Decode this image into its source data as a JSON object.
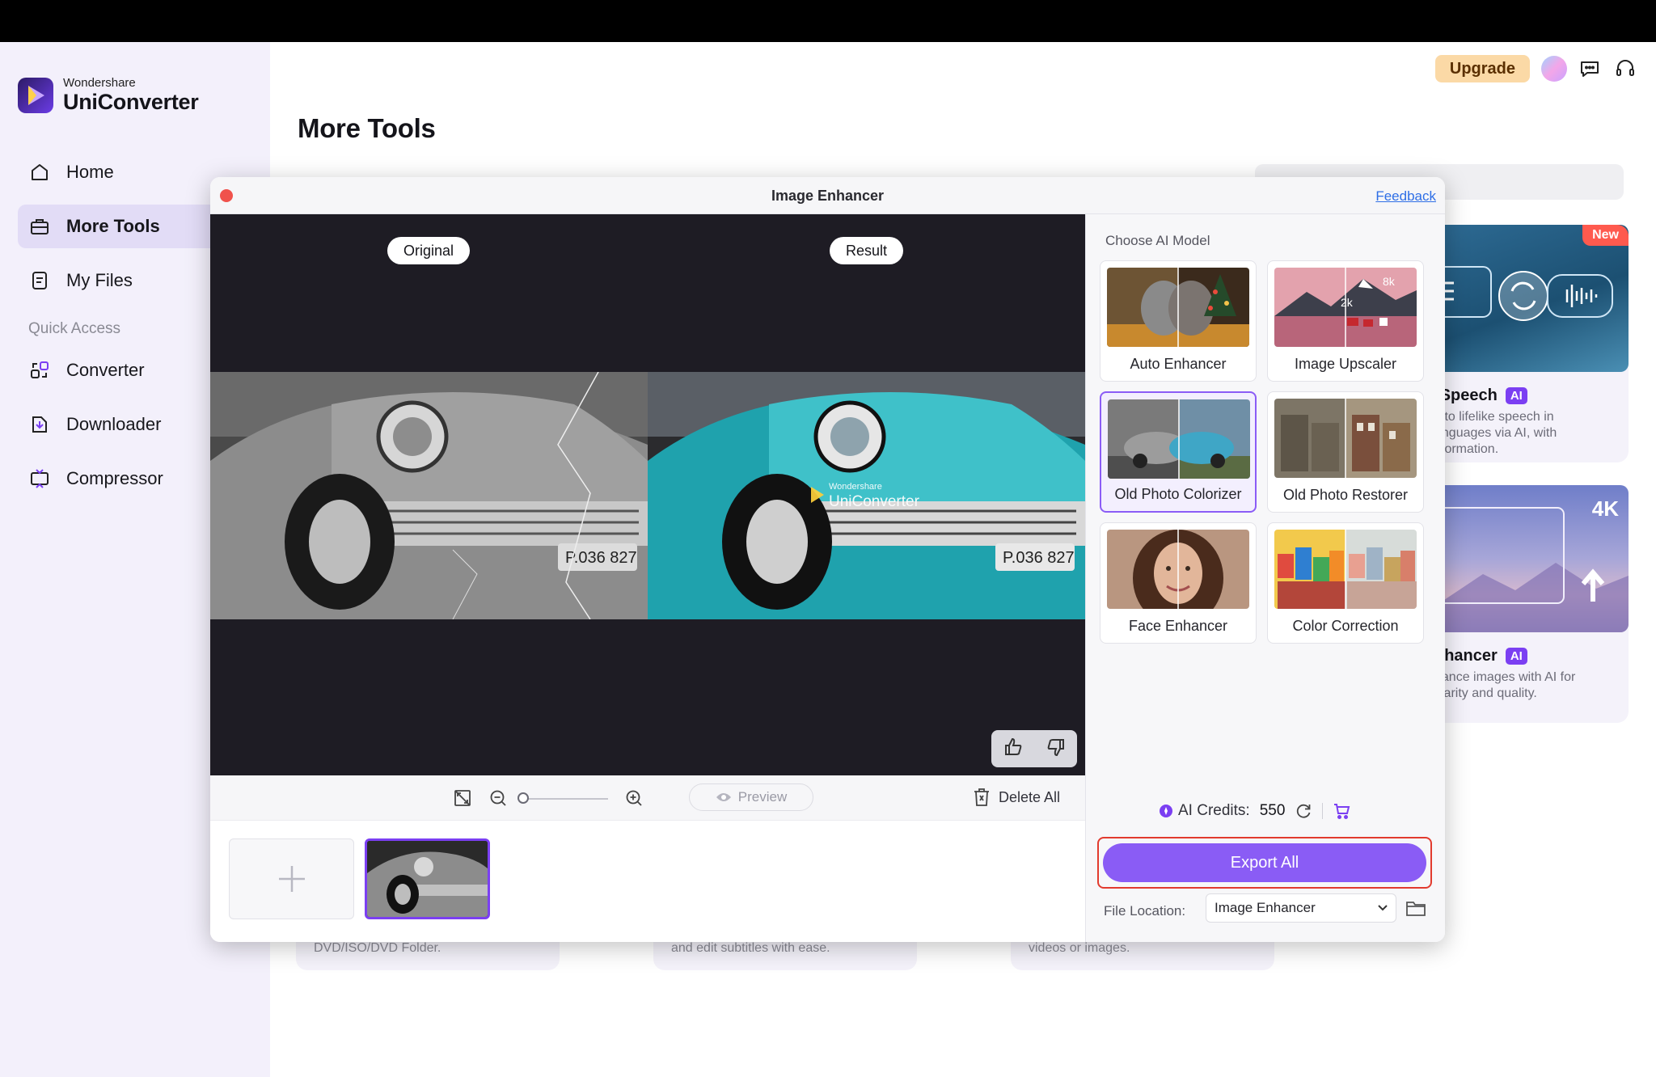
{
  "app": {
    "brand": "Wondershare",
    "name": "UniConverter"
  },
  "sidebar": {
    "items": [
      {
        "label": "Home",
        "icon": "home-icon"
      },
      {
        "label": "More Tools",
        "icon": "toolbox-icon"
      },
      {
        "label": "My Files",
        "icon": "file-icon"
      }
    ],
    "quick_access_label": "Quick Access",
    "quick_items": [
      {
        "label": "Converter",
        "icon": "converter-icon"
      },
      {
        "label": "Downloader",
        "icon": "downloader-icon"
      },
      {
        "label": "Compressor",
        "icon": "compressor-icon"
      }
    ]
  },
  "header": {
    "upgrade_label": "Upgrade",
    "icons": [
      "avatar",
      "chat-icon",
      "headset-icon"
    ]
  },
  "main": {
    "title": "More Tools",
    "cards": [
      {
        "badge": "New",
        "title": "-Speech",
        "ai": "AI",
        "desc": "into lifelike speech in\nanguages via AI, with\nsformation."
      },
      {
        "badge_text": "4K",
        "title": "nhancer",
        "ai": "AI",
        "desc": "nance images with AI for\nclarity and quality."
      }
    ],
    "bottom_descs": [
      "DVD/ISO/DVD Folder.",
      "and edit subtitles with ease.",
      "videos or images."
    ]
  },
  "modal": {
    "title": "Image Enhancer",
    "feedback": "Feedback",
    "original_tag": "Original",
    "result_tag": "Result",
    "watermark_brand": "Wondershare",
    "watermark_name": "UniConverter",
    "plate_text": "P.036 827",
    "toolbar": {
      "preview_label": "Preview",
      "delete_all_label": "Delete All",
      "zoom_level": 0
    },
    "choose_label": "Choose AI Model",
    "models": [
      {
        "label": "Auto Enhancer",
        "selected": false
      },
      {
        "label": "Image Upscaler",
        "selected": false,
        "tags": [
          "8k",
          "2k"
        ]
      },
      {
        "label": "Old Photo Colorizer",
        "selected": true
      },
      {
        "label": "Old Photo Restorer",
        "selected": false
      },
      {
        "label": "Face Enhancer",
        "selected": false
      },
      {
        "label": "Color Correction",
        "selected": false
      }
    ],
    "credits_label": "AI Credits:",
    "credits_value": "550",
    "export_label": "Export All",
    "file_location_label": "File Location:",
    "file_location_value": "Image Enhancer"
  },
  "colors": {
    "accent": "#8a5cf5",
    "highlight": "#e23b2e",
    "upgrade_bg": "#fbd9a6",
    "sidebar_bg": "#f3f0fb"
  }
}
